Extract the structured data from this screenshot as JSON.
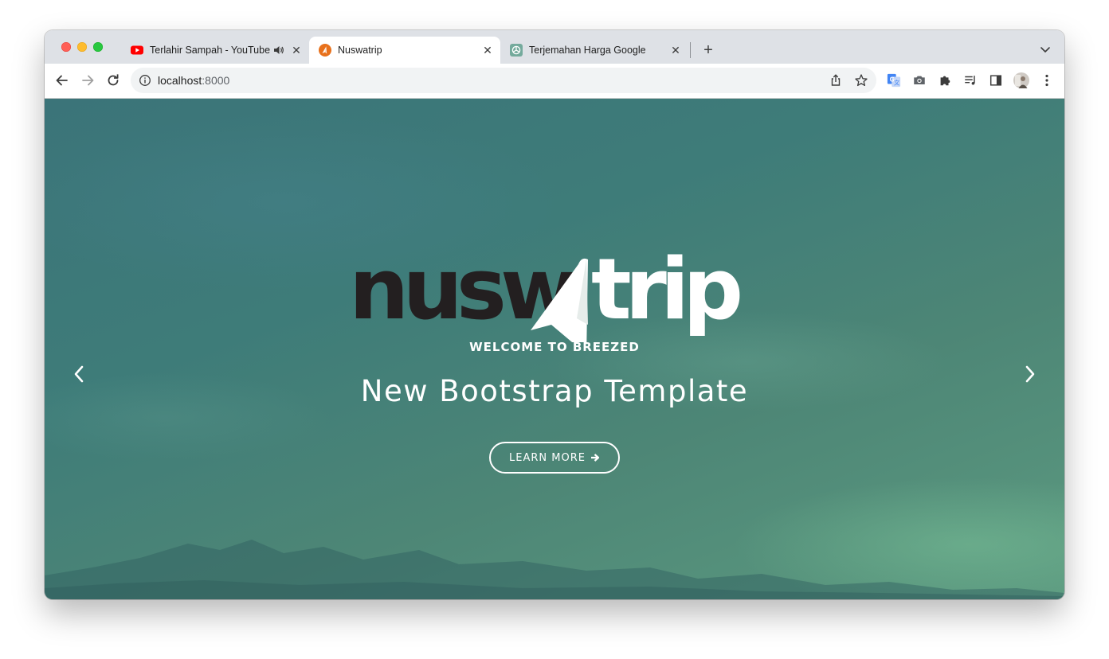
{
  "browser": {
    "tabs": [
      {
        "title": "Terlahir Sampah - YouTube",
        "favicon": "youtube-icon",
        "audible": true,
        "active": false
      },
      {
        "title": "Nuswatrip",
        "favicon": "nuswatrip-icon",
        "active": true
      },
      {
        "title": "Terjemahan Harga Google",
        "favicon": "chatgpt-icon",
        "active": false
      }
    ],
    "address": {
      "host": "localhost",
      "port": ":8000"
    },
    "toolbar_icons": [
      "back-icon",
      "forward-icon",
      "reload-icon",
      "info-icon",
      "share-icon",
      "star-icon",
      "google-translate-icon",
      "camera-icon",
      "extensions-icon",
      "media-icon",
      "side-panel-icon",
      "profile-avatar",
      "menu-icon"
    ]
  },
  "hero": {
    "logo": {
      "dark_part": "nusw",
      "light_part": "trip"
    },
    "welcome": "WELCOME TO BREEZED",
    "headline": "New Bootstrap Template",
    "cta_label": "LEARN MORE"
  },
  "colors": {
    "hero_bg": "#3e7c79",
    "logo_dark": "#231f20",
    "logo_light": "#ffffff",
    "tab_strip": "#dee1e6",
    "omnibox": "#f1f3f4"
  }
}
